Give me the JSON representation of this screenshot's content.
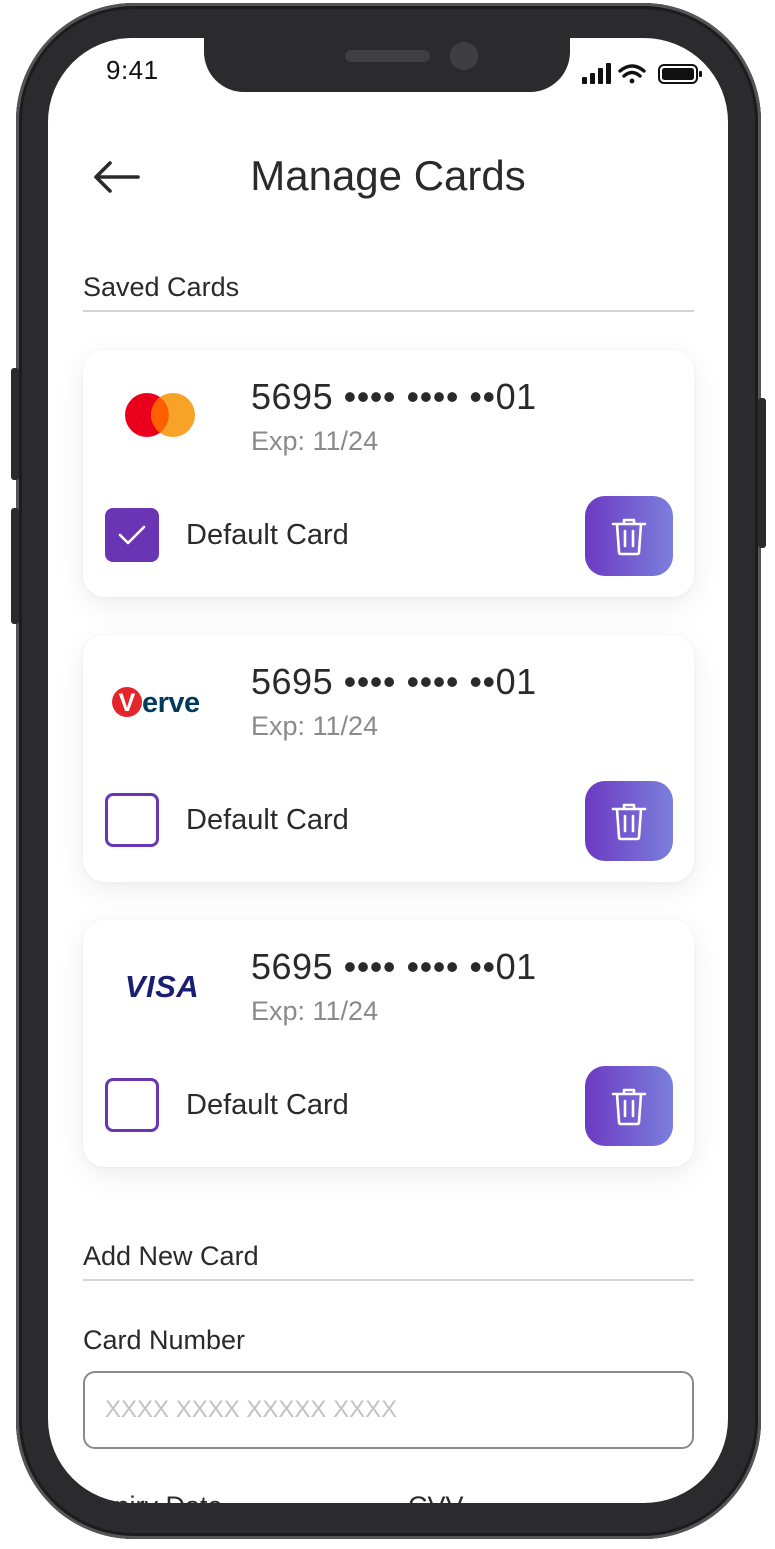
{
  "status_bar": {
    "time": "9:41"
  },
  "header": {
    "title": "Manage Cards"
  },
  "saved_section": {
    "title": "Saved Cards"
  },
  "cards": [
    {
      "brand": "mastercard",
      "number": "5695 •••• •••• ••01",
      "expiry": "Exp: 11/24",
      "default_label": "Default Card",
      "is_default": true
    },
    {
      "brand": "verve",
      "brand_text": "Verve",
      "number": "5695 •••• •••• ••01",
      "expiry": "Exp: 11/24",
      "default_label": "Default Card",
      "is_default": false
    },
    {
      "brand": "visa",
      "brand_text": "VISA",
      "number": "5695 •••• •••• ••01",
      "expiry": "Exp: 11/24",
      "default_label": "Default Card",
      "is_default": false
    }
  ],
  "add_section": {
    "title": "Add New Card",
    "card_number_label": "Card Number",
    "card_number_placeholder": "XXXX XXXX XXXXX XXXX",
    "card_number_value": "",
    "expiry_label": "Expiry Date",
    "cvv_label": "CVV"
  },
  "colors": {
    "accent": "#6a35b4",
    "delete_gradient_start": "#6c3ac2",
    "delete_gradient_end": "#7b7fdc",
    "mastercard_red": "#eb001b",
    "mastercard_orange": "#f79e1b",
    "verve_red": "#e4252b",
    "verve_navy": "#003a5d",
    "visa_blue": "#1a1f71"
  }
}
